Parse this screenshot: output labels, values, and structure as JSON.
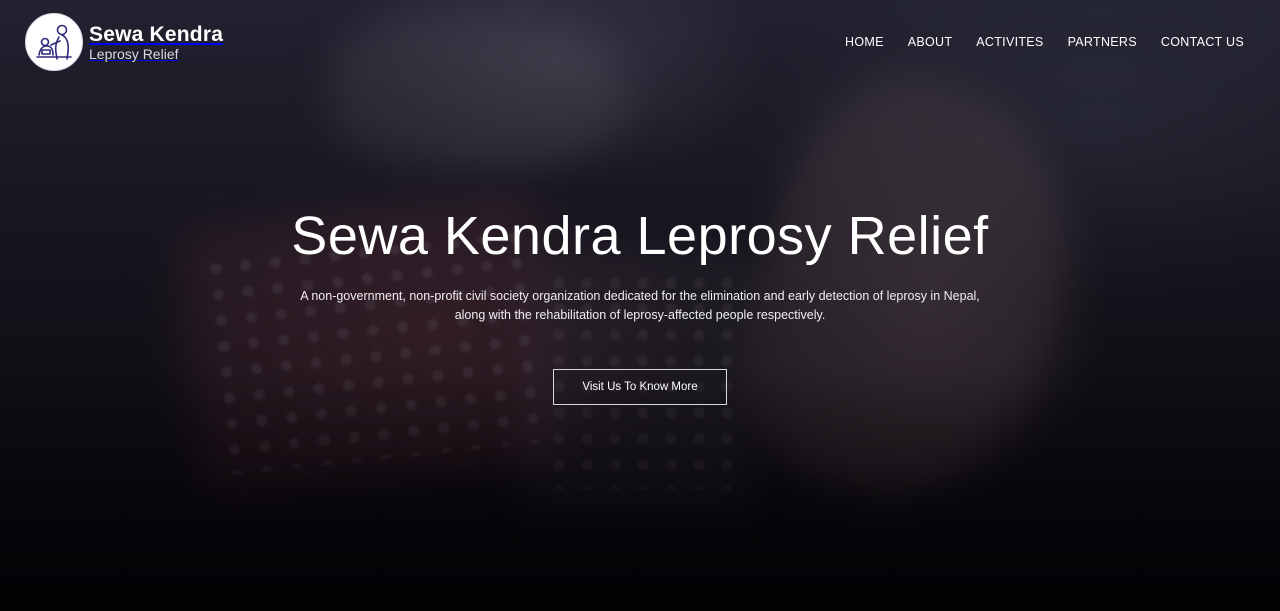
{
  "brand": {
    "name": "Sewa Kendra",
    "subtitle": "Leprosy Relief"
  },
  "nav": {
    "items": [
      {
        "label": "HOME"
      },
      {
        "label": "ABOUT"
      },
      {
        "label": "ACTIVITES"
      },
      {
        "label": "PARTNERS"
      },
      {
        "label": "CONTACT US"
      }
    ]
  },
  "hero": {
    "title": "Sewa Kendra Leprosy Relief",
    "description_line1": "A non-government, non-profit civil society organization dedicated for the elimination and early detection of leprosy in Nepal,",
    "description_line2": "along with the rehabilitation of leprosy-affected people respectively.",
    "cta_label": "Visit Us To Know More"
  },
  "colors": {
    "text": "#ffffff",
    "background": "#0b0a10",
    "logo_ink": "#2f2a7a"
  },
  "icons": {
    "logo": "caregiver-illustration-icon"
  }
}
